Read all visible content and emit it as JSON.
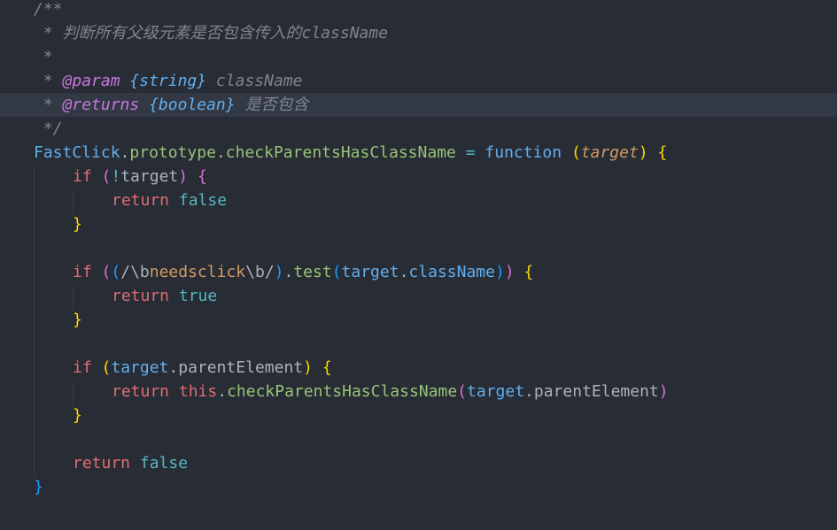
{
  "editor": {
    "lines": [
      {
        "indent": 38,
        "tokens": [
          {
            "t": "/**",
            "c": "c-comment"
          }
        ]
      },
      {
        "indent": 38,
        "tokens": [
          {
            "t": " * 判断所有父级元素是否包含传入的className",
            "c": "c-comment"
          }
        ]
      },
      {
        "indent": 38,
        "tokens": [
          {
            "t": " *",
            "c": "c-comment"
          }
        ]
      },
      {
        "indent": 38,
        "tokens": [
          {
            "t": " * ",
            "c": "c-comment"
          },
          {
            "t": "@param",
            "c": "c-tag"
          },
          {
            "t": " ",
            "c": "c-comment"
          },
          {
            "t": "{string}",
            "c": "c-type"
          },
          {
            "t": " className",
            "c": "c-param"
          }
        ]
      },
      {
        "indent": 38,
        "current": true,
        "tokens": [
          {
            "t": " * ",
            "c": "c-comment"
          },
          {
            "t": "@returns",
            "c": "c-tag"
          },
          {
            "t": " ",
            "c": "c-comment"
          },
          {
            "t": "{boolean}",
            "c": "c-type"
          },
          {
            "t": " 是否包含",
            "c": "c-param"
          }
        ]
      },
      {
        "indent": 38,
        "tokens": [
          {
            "t": " */",
            "c": "c-comment"
          }
        ]
      },
      {
        "indent": 38,
        "tokens": [
          {
            "t": "FastClick",
            "c": "c-class"
          },
          {
            "t": ".",
            "c": "c-punct"
          },
          {
            "t": "prototype",
            "c": "c-method"
          },
          {
            "t": ".",
            "c": "c-punct"
          },
          {
            "t": "checkParentsHasClassName",
            "c": "c-method"
          },
          {
            "t": " ",
            "c": "c-plain"
          },
          {
            "t": "=",
            "c": "c-op"
          },
          {
            "t": " ",
            "c": "c-plain"
          },
          {
            "t": "function",
            "c": "c-storage"
          },
          {
            "t": " ",
            "c": "c-plain"
          },
          {
            "t": "(",
            "c": "c-brace1"
          },
          {
            "t": "target",
            "c": "c-paramname"
          },
          {
            "t": ")",
            "c": "c-brace1"
          },
          {
            "t": " ",
            "c": "c-plain"
          },
          {
            "t": "{",
            "c": "c-brace1"
          }
        ]
      },
      {
        "indent": 82,
        "tokens": [
          {
            "t": "if",
            "c": "c-kw"
          },
          {
            "t": " ",
            "c": "c-plain"
          },
          {
            "t": "(",
            "c": "c-brace2"
          },
          {
            "t": "!",
            "c": "c-op"
          },
          {
            "t": "target",
            "c": "c-plain"
          },
          {
            "t": ")",
            "c": "c-brace2"
          },
          {
            "t": " ",
            "c": "c-plain"
          },
          {
            "t": "{",
            "c": "c-brace2"
          }
        ]
      },
      {
        "indent": 126,
        "tokens": [
          {
            "t": "return",
            "c": "c-kw"
          },
          {
            "t": " ",
            "c": "c-plain"
          },
          {
            "t": "false",
            "c": "c-bool"
          }
        ]
      },
      {
        "indent": 82,
        "tokens": [
          {
            "t": "}",
            "c": "c-brace1"
          }
        ]
      },
      {
        "indent": 82,
        "tokens": []
      },
      {
        "indent": 82,
        "tokens": [
          {
            "t": "if",
            "c": "c-kw"
          },
          {
            "t": " ",
            "c": "c-plain"
          },
          {
            "t": "(",
            "c": "c-brace2"
          },
          {
            "t": "(",
            "c": "c-brace3"
          },
          {
            "t": "/",
            "c": "c-regex-esc"
          },
          {
            "t": "\\b",
            "c": "c-regex-esc"
          },
          {
            "t": "needsclick",
            "c": "c-regex"
          },
          {
            "t": "\\b",
            "c": "c-regex-esc"
          },
          {
            "t": "/",
            "c": "c-regex-esc"
          },
          {
            "t": ")",
            "c": "c-brace3"
          },
          {
            "t": ".",
            "c": "c-punct"
          },
          {
            "t": "test",
            "c": "c-method"
          },
          {
            "t": "(",
            "c": "c-brace3"
          },
          {
            "t": "target",
            "c": "c-var"
          },
          {
            "t": ".",
            "c": "c-punct"
          },
          {
            "t": "className",
            "c": "c-var"
          },
          {
            "t": ")",
            "c": "c-brace3"
          },
          {
            "t": ")",
            "c": "c-brace2"
          },
          {
            "t": " ",
            "c": "c-plain"
          },
          {
            "t": "{",
            "c": "c-brace1"
          }
        ]
      },
      {
        "indent": 126,
        "tokens": [
          {
            "t": "return",
            "c": "c-kw"
          },
          {
            "t": " ",
            "c": "c-plain"
          },
          {
            "t": "true",
            "c": "c-bool"
          }
        ]
      },
      {
        "indent": 82,
        "tokens": [
          {
            "t": "}",
            "c": "c-brace1"
          }
        ]
      },
      {
        "indent": 82,
        "tokens": []
      },
      {
        "indent": 82,
        "tokens": [
          {
            "t": "if",
            "c": "c-kw"
          },
          {
            "t": " ",
            "c": "c-plain"
          },
          {
            "t": "(",
            "c": "c-brace1"
          },
          {
            "t": "target",
            "c": "c-var"
          },
          {
            "t": ".",
            "c": "c-punct"
          },
          {
            "t": "parentElement",
            "c": "c-plain"
          },
          {
            "t": ")",
            "c": "c-brace1"
          },
          {
            "t": " ",
            "c": "c-plain"
          },
          {
            "t": "{",
            "c": "c-brace1"
          }
        ]
      },
      {
        "indent": 126,
        "tokens": [
          {
            "t": "return",
            "c": "c-kw"
          },
          {
            "t": " ",
            "c": "c-plain"
          },
          {
            "t": "this",
            "c": "c-this"
          },
          {
            "t": ".",
            "c": "c-punct"
          },
          {
            "t": "checkParentsHasClassName",
            "c": "c-method"
          },
          {
            "t": "(",
            "c": "c-brace2"
          },
          {
            "t": "target",
            "c": "c-var"
          },
          {
            "t": ".",
            "c": "c-punct"
          },
          {
            "t": "parentElement",
            "c": "c-plain"
          },
          {
            "t": ")",
            "c": "c-brace2"
          }
        ]
      },
      {
        "indent": 82,
        "tokens": [
          {
            "t": "}",
            "c": "c-brace1"
          }
        ]
      },
      {
        "indent": 82,
        "tokens": []
      },
      {
        "indent": 82,
        "tokens": [
          {
            "t": "return",
            "c": "c-kw"
          },
          {
            "t": " ",
            "c": "c-plain"
          },
          {
            "t": "false",
            "c": "c-bool"
          }
        ]
      },
      {
        "indent": 38,
        "tokens": [
          {
            "t": "}",
            "c": "c-brace3"
          }
        ]
      },
      {
        "indent": 38,
        "tokens": []
      }
    ]
  }
}
